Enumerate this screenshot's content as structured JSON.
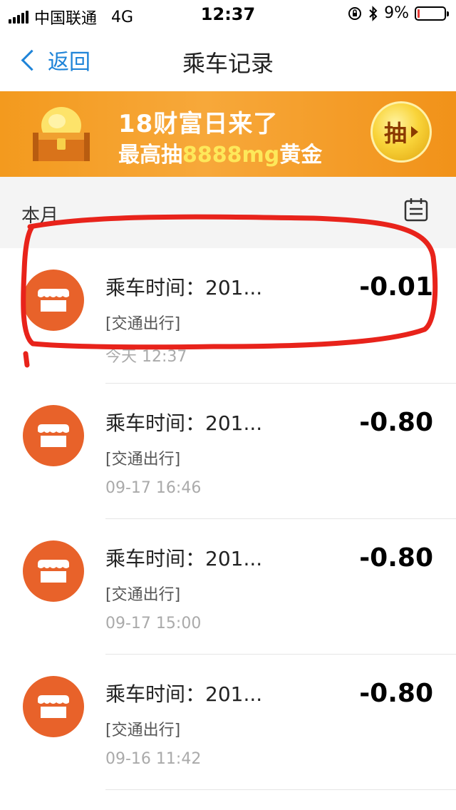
{
  "status_bar": {
    "carrier": "中国联通",
    "network": "4G",
    "time": "12:37",
    "battery_percent": "9%",
    "battery_level": 0.09,
    "battery_color": "#e53935"
  },
  "nav": {
    "back_label": "返回",
    "title": "乘车记录",
    "accent_color": "#1f84d8"
  },
  "banner": {
    "title": "18财富日来了",
    "subtitle_prefix": "最高抽",
    "subtitle_highlight": "8888mg",
    "subtitle_suffix": "黄金",
    "button_label": "抽",
    "icon": "treasure-chest-icon"
  },
  "section": {
    "month_label": "本月",
    "calendar_icon": "calendar-icon"
  },
  "records": [
    {
      "title": "乘车时间：201...",
      "category": "[交通出行]",
      "time": "今天  12:37",
      "amount": "-0.01",
      "icon": "store-icon",
      "highlighted": true
    },
    {
      "title": "乘车时间：201...",
      "category": "[交通出行]",
      "time": "09-17  16:46",
      "amount": "-0.80",
      "icon": "store-icon"
    },
    {
      "title": "乘车时间：201...",
      "category": "[交通出行]",
      "time": "09-17  15:00",
      "amount": "-0.80",
      "icon": "store-icon"
    },
    {
      "title": "乘车时间：201...",
      "category": "[交通出行]",
      "time": "09-16  11:42",
      "amount": "-0.80",
      "icon": "store-icon"
    }
  ],
  "colors": {
    "record_icon_bg": "#e8622a",
    "annotation_red": "#e8231b",
    "banner_orange": "#f39a1e"
  }
}
